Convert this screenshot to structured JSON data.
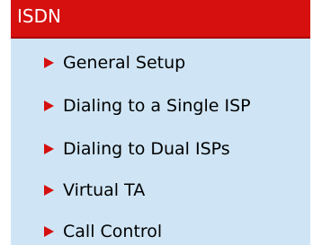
{
  "menu": {
    "title": "ISDN",
    "colors": {
      "header_background": "#d60f0f",
      "body_background": "#cfe5f5",
      "arrow": "#d60f0f",
      "title_text": "#ffffff",
      "item_text": "#000000"
    },
    "items": [
      {
        "label": "General Setup",
        "icon": "red-triangle-arrow-icon"
      },
      {
        "label": "Dialing to a Single ISP",
        "icon": "red-triangle-arrow-icon"
      },
      {
        "label": "Dialing to Dual ISPs",
        "icon": "red-triangle-arrow-icon"
      },
      {
        "label": "Virtual TA",
        "icon": "red-triangle-arrow-icon"
      },
      {
        "label": "Call Control",
        "icon": "red-triangle-arrow-icon"
      }
    ]
  }
}
